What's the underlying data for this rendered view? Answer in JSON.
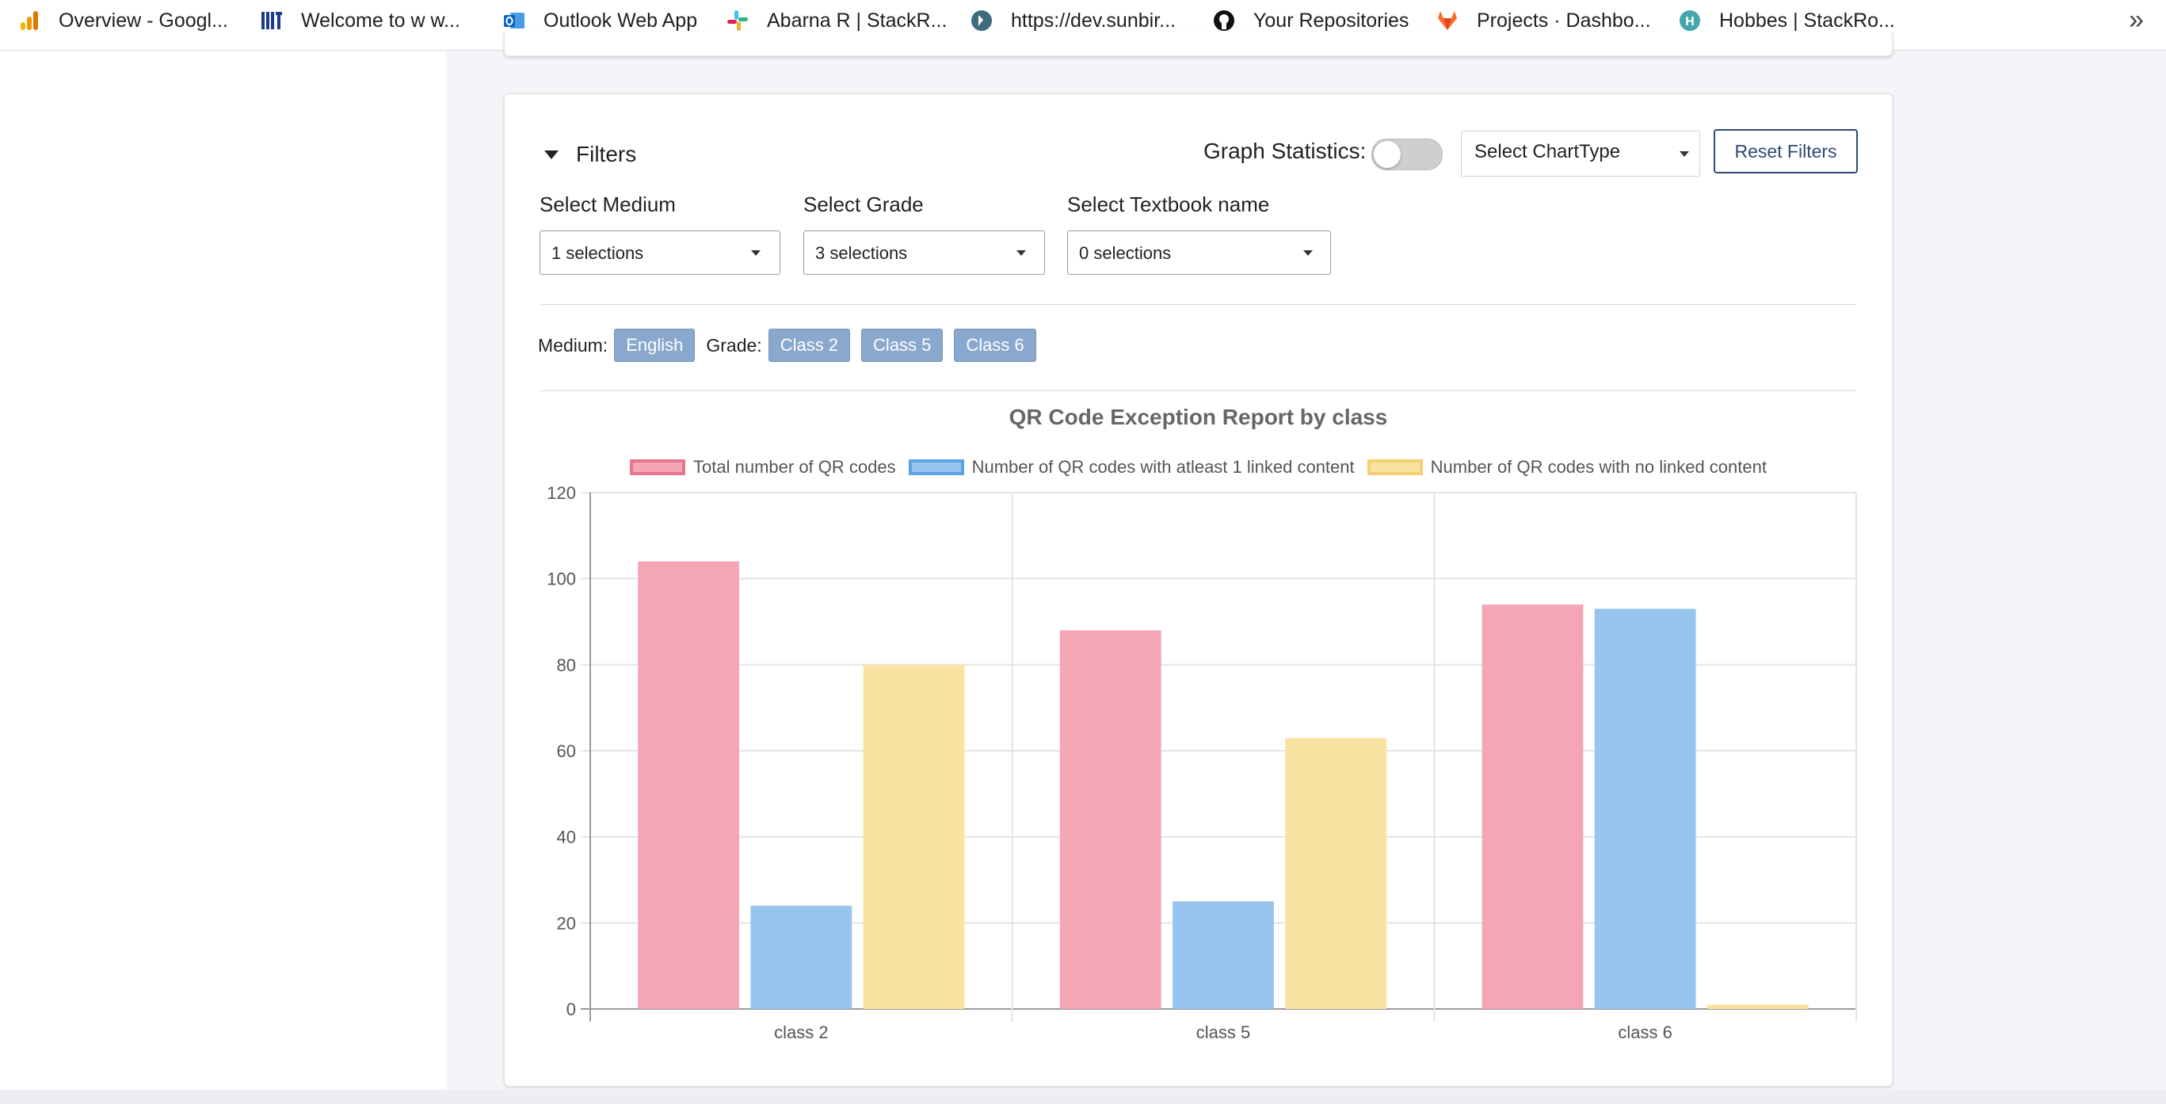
{
  "bookmarks": [
    {
      "label": "Overview - Googl...",
      "icon": "analytics-icon"
    },
    {
      "label": "Welcome to w w...",
      "icon": "niit-logo-icon"
    },
    {
      "label": "Outlook Web App",
      "icon": "outlook-icon"
    },
    {
      "label": "Abarna R | StackR...",
      "icon": "slack-icon"
    },
    {
      "label": "https://dev.sunbir...",
      "icon": "sunbird-icon"
    },
    {
      "label": "Your Repositories",
      "icon": "github-icon"
    },
    {
      "label": "Projects · Dashbo...",
      "icon": "gitlab-icon"
    },
    {
      "label": "Hobbes | StackRo...",
      "icon": "hobbes-icon"
    }
  ],
  "bookmarks_more": "»",
  "filters": {
    "title": "Filters",
    "graph_statistics_label": "Graph Statistics:",
    "graph_statistics_on": false,
    "chart_type_placeholder": "Select ChartType",
    "reset_label": "Reset Filters",
    "selects": [
      {
        "label": "Select Medium",
        "value": "1 selections"
      },
      {
        "label": "Select Grade",
        "value": "3 selections"
      },
      {
        "label": "Select Textbook name",
        "value": "0 selections"
      }
    ]
  },
  "applied": {
    "medium_label": "Medium:",
    "medium": [
      "English"
    ],
    "grade_label": "Grade:",
    "grades": [
      "Class 2",
      "Class 5",
      "Class 6"
    ]
  },
  "chart_data": {
    "type": "bar",
    "title": "QR Code Exception Report by class",
    "categories": [
      "class 2",
      "class 5",
      "class 6"
    ],
    "series": [
      {
        "name": "Total number of QR codes",
        "values": [
          104,
          88,
          94
        ],
        "fill": "#f4a6b5",
        "stroke": "#e8758c"
      },
      {
        "name": "Number of QR codes with atleast 1 linked content",
        "values": [
          24,
          25,
          93
        ],
        "fill": "#97c5ee",
        "stroke": "#5aa3e3"
      },
      {
        "name": "Number of QR codes with no linked content",
        "values": [
          80,
          63,
          1
        ],
        "fill": "#f9e2a2",
        "stroke": "#f2cf6f"
      }
    ],
    "ylim": [
      0,
      120
    ],
    "yticks": [
      0,
      20,
      40,
      60,
      80,
      100,
      120
    ],
    "grid": true,
    "legend": "top"
  }
}
